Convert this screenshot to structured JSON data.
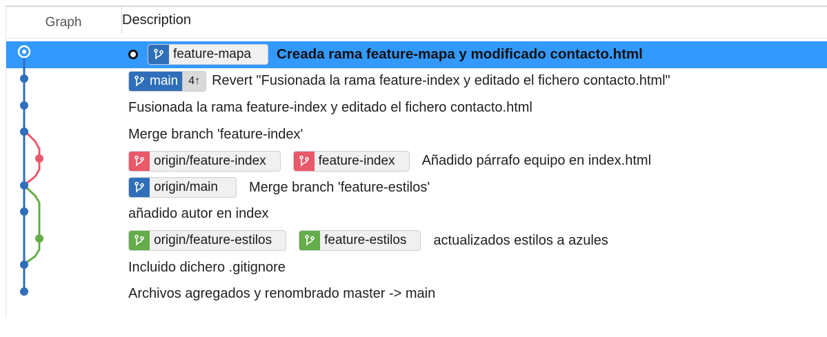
{
  "header": {
    "graph": "Graph",
    "description": "Description"
  },
  "colors": {
    "main": "#2f6fba",
    "index": "#e8596a",
    "estilos": "#65ad4a",
    "selected": "#3399ff"
  },
  "icons": {
    "branch": "branch-icon",
    "head": "head-commit-icon"
  },
  "commits": [
    {
      "message": "Creada rama feature-mapa y modificado contacto.html",
      "tags": [
        {
          "name": "feature-mapa",
          "color": "blue"
        }
      ]
    },
    {
      "message": "Revert \"Fusionada la rama feature-index y editado el fichero contacto.html\"",
      "tags": [
        {
          "name": "main",
          "count": "4↑",
          "color": "blue"
        }
      ]
    },
    {
      "message": "Fusionada la rama feature-index y editado el fichero contacto.html",
      "tags": []
    },
    {
      "message": "Merge branch 'feature-index'",
      "tags": []
    },
    {
      "message": "Añadido párrafo equipo en index.html",
      "tags": [
        {
          "name": "origin/feature-index",
          "color": "red"
        },
        {
          "name": "feature-index",
          "color": "red"
        }
      ]
    },
    {
      "message": "Merge branch 'feature-estilos'",
      "tags": [
        {
          "name": "origin/main",
          "color": "blue"
        }
      ]
    },
    {
      "message": "añadido autor en index",
      "tags": []
    },
    {
      "message": "actualizados estilos a azules",
      "tags": [
        {
          "name": "origin/feature-estilos",
          "color": "green"
        },
        {
          "name": "feature-estilos",
          "color": "green"
        }
      ]
    },
    {
      "message": "Incluido dichero .gitignore",
      "tags": []
    },
    {
      "message": "Archivos agregados y renombrado master -> main",
      "tags": []
    }
  ]
}
